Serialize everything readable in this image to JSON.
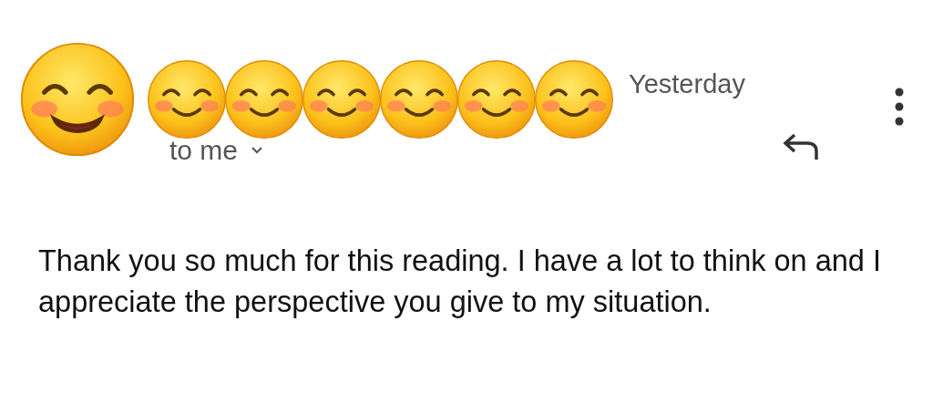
{
  "sender": {
    "avatar": {
      "kind": "emoji"
    },
    "name_stickers": [
      {
        "kind": "emoji"
      },
      {
        "kind": "emoji"
      },
      {
        "kind": "emoji"
      },
      {
        "kind": "emoji"
      },
      {
        "kind": "emoji"
      },
      {
        "kind": "emoji"
      }
    ]
  },
  "message": {
    "date": "Yesterday",
    "recipient": "to me",
    "body": "Thank you so much for this reading. I have a lot to think on and I appreciate the perspective you give to my situation."
  }
}
